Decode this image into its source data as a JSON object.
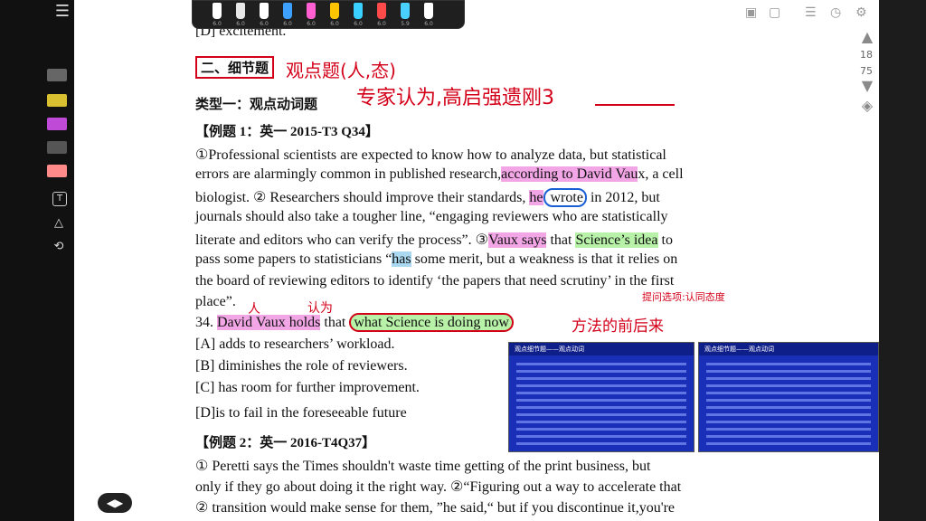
{
  "toolbar": {
    "pen_sizes": [
      "6.0",
      "6.0",
      "6.0",
      "6.0",
      "6.0",
      "6.0",
      "6.0",
      "6.0",
      "5.9",
      "6.0"
    ],
    "pen_colors": [
      "#ffffff",
      "#e8e8e8",
      "#ffffff",
      "#3da0ff",
      "#ff5fd0",
      "#ffc400",
      "#3ad0ff",
      "#ff4a4a",
      "#4ad0ff",
      "#ffffff"
    ]
  },
  "scroll": {
    "page_current": "18",
    "page_total": "75"
  },
  "doc": {
    "line0": "[D] excitement.",
    "section_title": "二、细节题",
    "type_title": "类型一：观点动词题",
    "ex1_title": "【例题 1：英一 2015-T3 Q34】",
    "p1_l1": "①Professional scientists are expected to know how to analyze data, but statistical",
    "p1_l2a": "errors are alarmingly common in published research,",
    "p1_l2b": "according to David Vau",
    "p1_l2c": "x, a cell",
    "p1_l3a": "biologist. ② Researchers should improve their standards, ",
    "p1_l3b": "he",
    "p1_l3c": " wrote",
    "p1_l3d": " in 2012, but",
    "p1_l4": "journals should also take a tougher line, “engaging reviewers who are statistically",
    "p1_l5a": "literate and editors who can verify the process”. ③",
    "p1_l5b": "Vaux says",
    "p1_l5c": " that ",
    "p1_l5d": "Science’s idea",
    "p1_l5e": " to",
    "p1_l6a": "pass some papers to statisticians “",
    "p1_l6b": "has",
    "p1_l6c": " some merit, but a weakness is that it relies on",
    "p1_l7": "the board of reviewing editors to identify ‘the papers that need scrutiny’ in the first",
    "p1_l8": "place”.",
    "q34a": "34. ",
    "q34b": "David Vaux holds",
    "q34c": " that ",
    "q34d": "what Science is doing now",
    "optA": "[A] adds to researchers’ workload.",
    "optB": "[B] diminishes the role of reviewers.",
    "optC": "[C] has room for further improvement.",
    "optD": "[D]is to fail in the foreseeable future",
    "ex2_title": "【例题 2：英一 2016-T4Q37】",
    "p2_l1": "① Peretti says the Times shouldn't waste time getting of the print business, but",
    "p2_l2": "only if they go about doing it the right way. ②“Figuring out a way to accelerate that",
    "p2_l3": "② transition would make sense for them, ”he said,“ but if you discontinue it,you're"
  },
  "ink": {
    "a1": "观点题(人,态)",
    "a2": "专家认为,高启强遗刚3",
    "a3": "人",
    "a4": "认为",
    "a5": "方法的前后来",
    "a6": "提问选项:认同态度"
  },
  "thumbs": {
    "t1_head": "观点细节题——观点动词",
    "t2_head": "观点细节题——观点动词"
  }
}
